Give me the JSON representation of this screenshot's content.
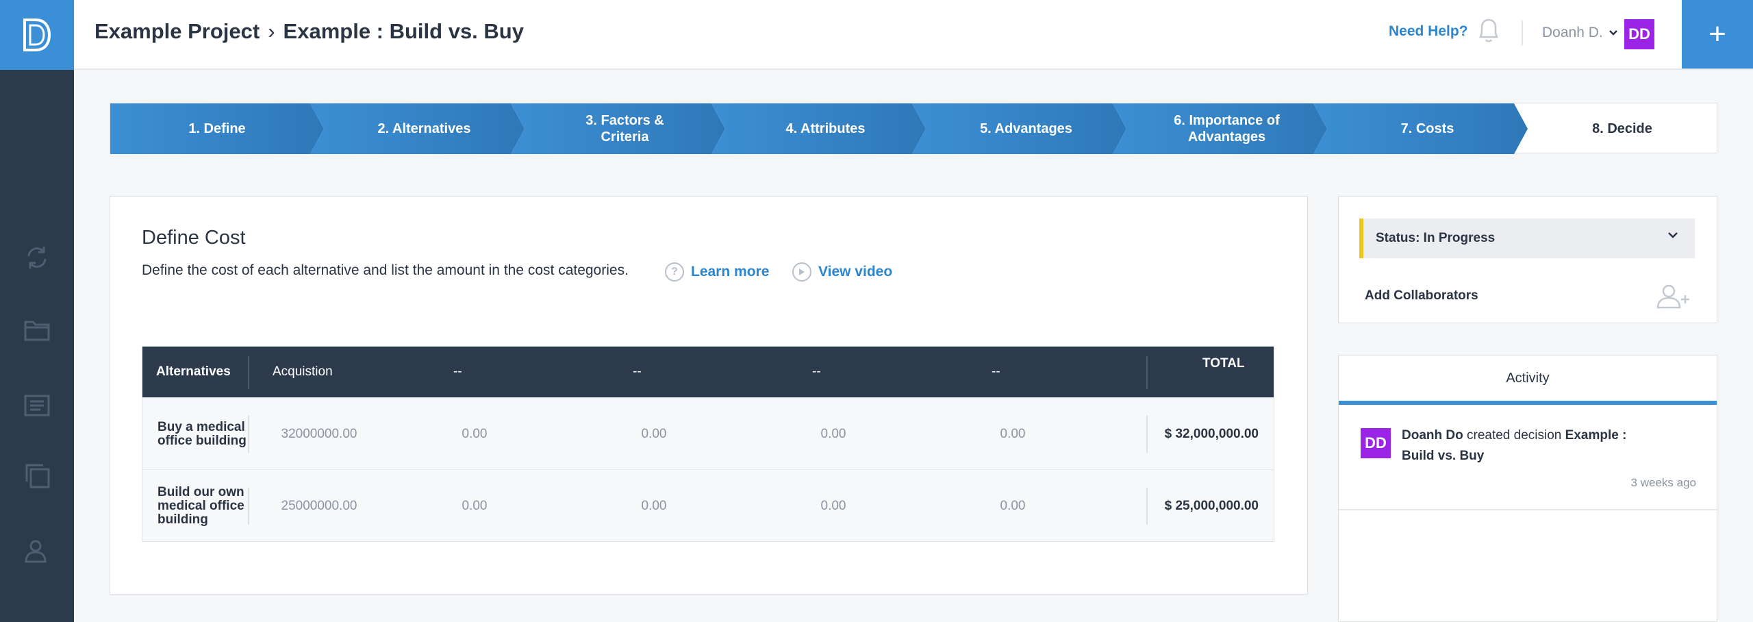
{
  "app": {
    "logo_letter": "D"
  },
  "header": {
    "breadcrumb": {
      "project": "Example Project",
      "separator": "›",
      "decision": "Example : Build vs. Buy"
    },
    "help_label": "Need Help?",
    "user_name": "Doanh D.",
    "user_initials": "DD",
    "add_label": "+"
  },
  "steps": [
    {
      "label": "1. Define",
      "state": "done"
    },
    {
      "label": "2. Alternatives",
      "state": "done"
    },
    {
      "label": "3. Factors & Criteria",
      "state": "done"
    },
    {
      "label": "4. Attributes",
      "state": "done"
    },
    {
      "label": "5. Advantages",
      "state": "done"
    },
    {
      "label": "6. Importance of Advantages",
      "state": "done"
    },
    {
      "label": "7. Costs",
      "state": "done"
    },
    {
      "label": "8. Decide",
      "state": "current"
    }
  ],
  "define_cost": {
    "title": "Define Cost",
    "description": "Define the cost of each alternative and list the amount in the cost categories.",
    "learn_more": "Learn more",
    "view_video": "View video",
    "help_glyph": "?",
    "columns": [
      "Alternatives",
      "Acquistion",
      "--",
      "--",
      "--",
      "--",
      "TOTAL"
    ],
    "rows": [
      {
        "name": "Buy a medical office building",
        "costs": [
          "32000000.00",
          "0.00",
          "0.00",
          "0.00",
          "0.00"
        ],
        "total": "$ 32,000,000.00"
      },
      {
        "name": "Build our own medical office building",
        "costs": [
          "25000000.00",
          "0.00",
          "0.00",
          "0.00",
          "0.00"
        ],
        "total": "$ 25,000,000.00"
      }
    ]
  },
  "status_panel": {
    "status_label": "Status: In Progress",
    "status_color": "#f0c419",
    "add_collaborators": "Add Collaborators"
  },
  "activity": {
    "tab_label": "Activity",
    "entries": [
      {
        "initials": "DD",
        "actor": "Doanh Do",
        "action": "created decision",
        "target": "Example : Build vs. Buy",
        "time": "3 weeks ago"
      }
    ]
  },
  "colors": {
    "accent": "#3b8fd6",
    "rail": "#2c3a4b",
    "avatar": "#9b24e6"
  }
}
